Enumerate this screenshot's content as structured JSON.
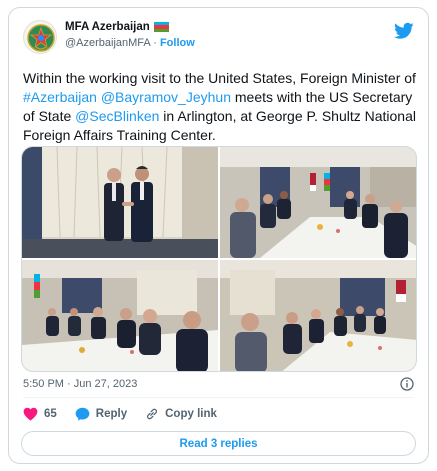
{
  "account": {
    "display_name": "MFA Azerbaijan",
    "handle": "@AzerbaijanMFA",
    "separator": "·",
    "follow_label": "Follow",
    "avatar_icon": "azerbaijan-emblem-icon",
    "flag_colors": [
      "#00b5e2",
      "#ef3340",
      "#509e2f"
    ]
  },
  "tweet": {
    "segments": [
      {
        "text": "Within the working visit to the United States, Foreign Minister of ",
        "link": false
      },
      {
        "text": "#Azerbaijan",
        "link": true
      },
      {
        "text": " ",
        "link": false
      },
      {
        "text": "@Bayramov_Jeyhun",
        "link": true
      },
      {
        "text": " meets with the US Secretary of State ",
        "link": false
      },
      {
        "text": "@SecBlinken",
        "link": true
      },
      {
        "text": " in Arlington, at George P. Shultz National Foreign Affairs Training Center.",
        "link": false
      }
    ],
    "photos": [
      {
        "description": "handshake"
      },
      {
        "description": "meeting-table-1"
      },
      {
        "description": "meeting-table-2"
      },
      {
        "description": "meeting-table-3"
      }
    ],
    "time": "5:50 PM",
    "date_separator": "·",
    "date": "Jun 27, 2023"
  },
  "actions": {
    "likes_count": "65",
    "reply_label": "Reply",
    "copy_link_label": "Copy link",
    "read_replies_label": "Read 3 replies"
  },
  "colors": {
    "accent": "#1d9bf0",
    "like": "#f91880",
    "text": "#0f1419",
    "muted": "#536471"
  }
}
